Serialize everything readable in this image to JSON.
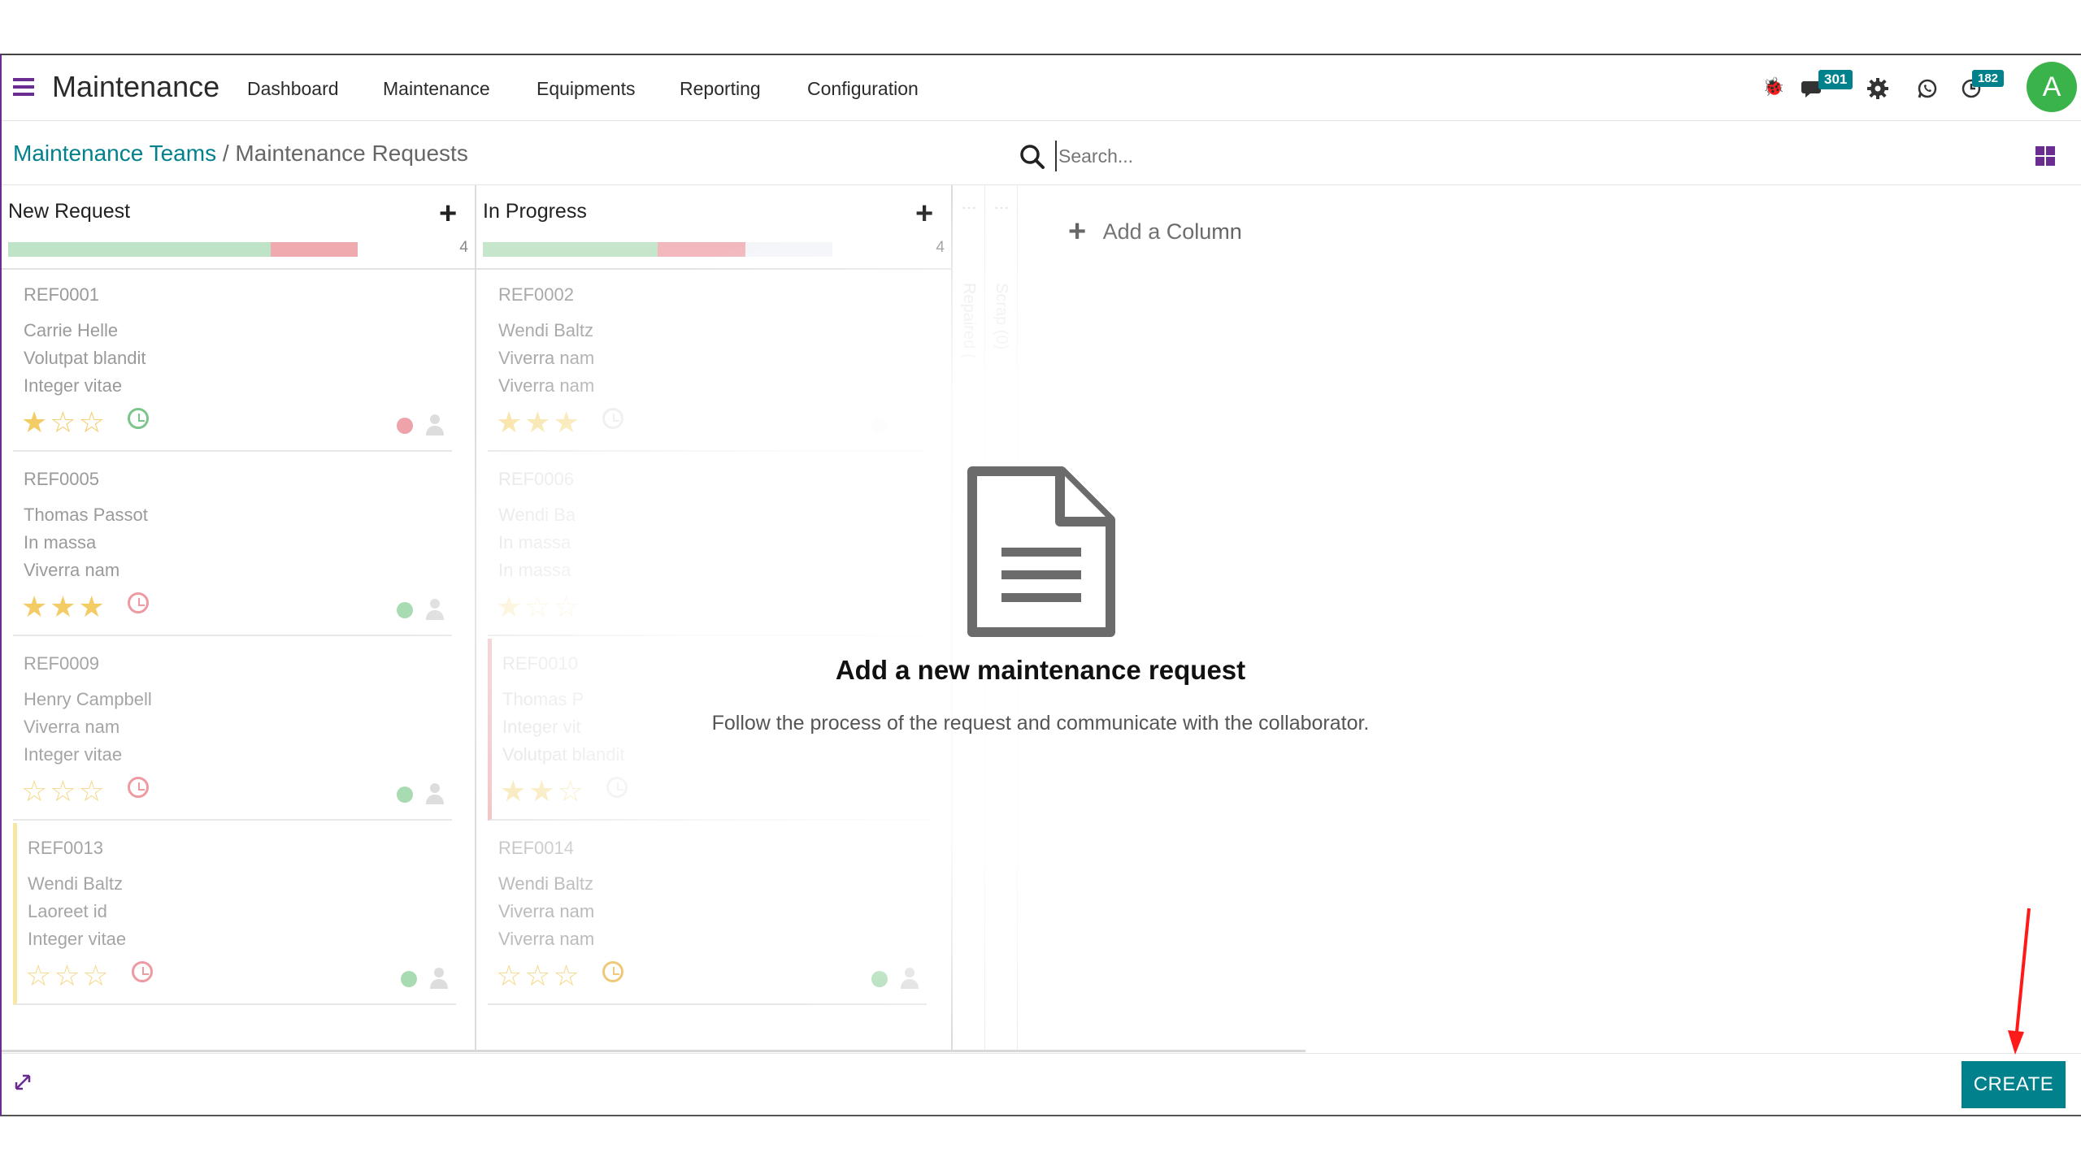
{
  "app": {
    "title": "Maintenance",
    "accent": "#6a2c91",
    "teal": "#00818c"
  },
  "nav": {
    "items": [
      "Dashboard",
      "Maintenance",
      "Equipments",
      "Reporting",
      "Configuration"
    ],
    "chat_badge": "301",
    "activity_badge": "182",
    "avatar_letter": "A"
  },
  "breadcrumb": {
    "parent": "Maintenance Teams",
    "separator": "/",
    "current": "Maintenance Requests"
  },
  "search": {
    "placeholder": "Search..."
  },
  "columns": [
    {
      "title": "New Request",
      "count": "4",
      "progress": {
        "green": 0.75,
        "red": 0.25
      },
      "cards": [
        {
          "ref": "REF0001",
          "lines": [
            "Carrie Helle",
            "Volutpat blandit",
            "Integer vitae"
          ],
          "stars": 1,
          "clock": "green",
          "dot": "red"
        },
        {
          "ref": "REF0005",
          "lines": [
            "Thomas Passot",
            "In massa",
            "Viverra nam"
          ],
          "stars": 3,
          "clock": "red",
          "dot": "green"
        },
        {
          "ref": "REF0009",
          "lines": [
            "Henry Campbell",
            "Viverra nam",
            "Integer vitae"
          ],
          "stars": 0,
          "clock": "red",
          "dot": "green"
        },
        {
          "ref": "REF0013",
          "lines": [
            "Wendi Baltz",
            "Laoreet id",
            "Integer vitae"
          ],
          "stars": 0,
          "clock": "red",
          "dot": "green"
        }
      ]
    },
    {
      "title": "In Progress",
      "count": "4",
      "progress": {
        "green": 0.5,
        "red": 0.25
      },
      "cards": [
        {
          "ref": "REF0002",
          "lines": [
            "Wendi Baltz",
            "Viverra nam",
            "Viverra nam"
          ],
          "stars": 3,
          "clock": "gray",
          "dot": "gray"
        },
        {
          "ref": "REF0006",
          "lines": [
            "Wendi Ba",
            "In massa",
            "In massa"
          ],
          "stars": 1,
          "clock": "gray",
          "dot": "gray"
        },
        {
          "ref": "REF0010",
          "lines": [
            "Thomas P",
            "Integer vit",
            "Volutpat blandit"
          ],
          "stars": 2,
          "clock": "gray",
          "dot": "gray"
        },
        {
          "ref": "REF0014",
          "lines": [
            "Wendi Baltz",
            "Viverra nam",
            "Viverra nam"
          ],
          "stars": 0,
          "clock": "orange",
          "dot": "green"
        }
      ]
    }
  ],
  "folded_columns": [
    "Repaired (",
    "Scrap (0)"
  ],
  "add_column": "Add a Column",
  "empty_state": {
    "title": "Add a new maintenance request",
    "text": "Follow the process of the request and communicate with the collaborator."
  },
  "footer": {
    "create_label": "CREATE"
  }
}
